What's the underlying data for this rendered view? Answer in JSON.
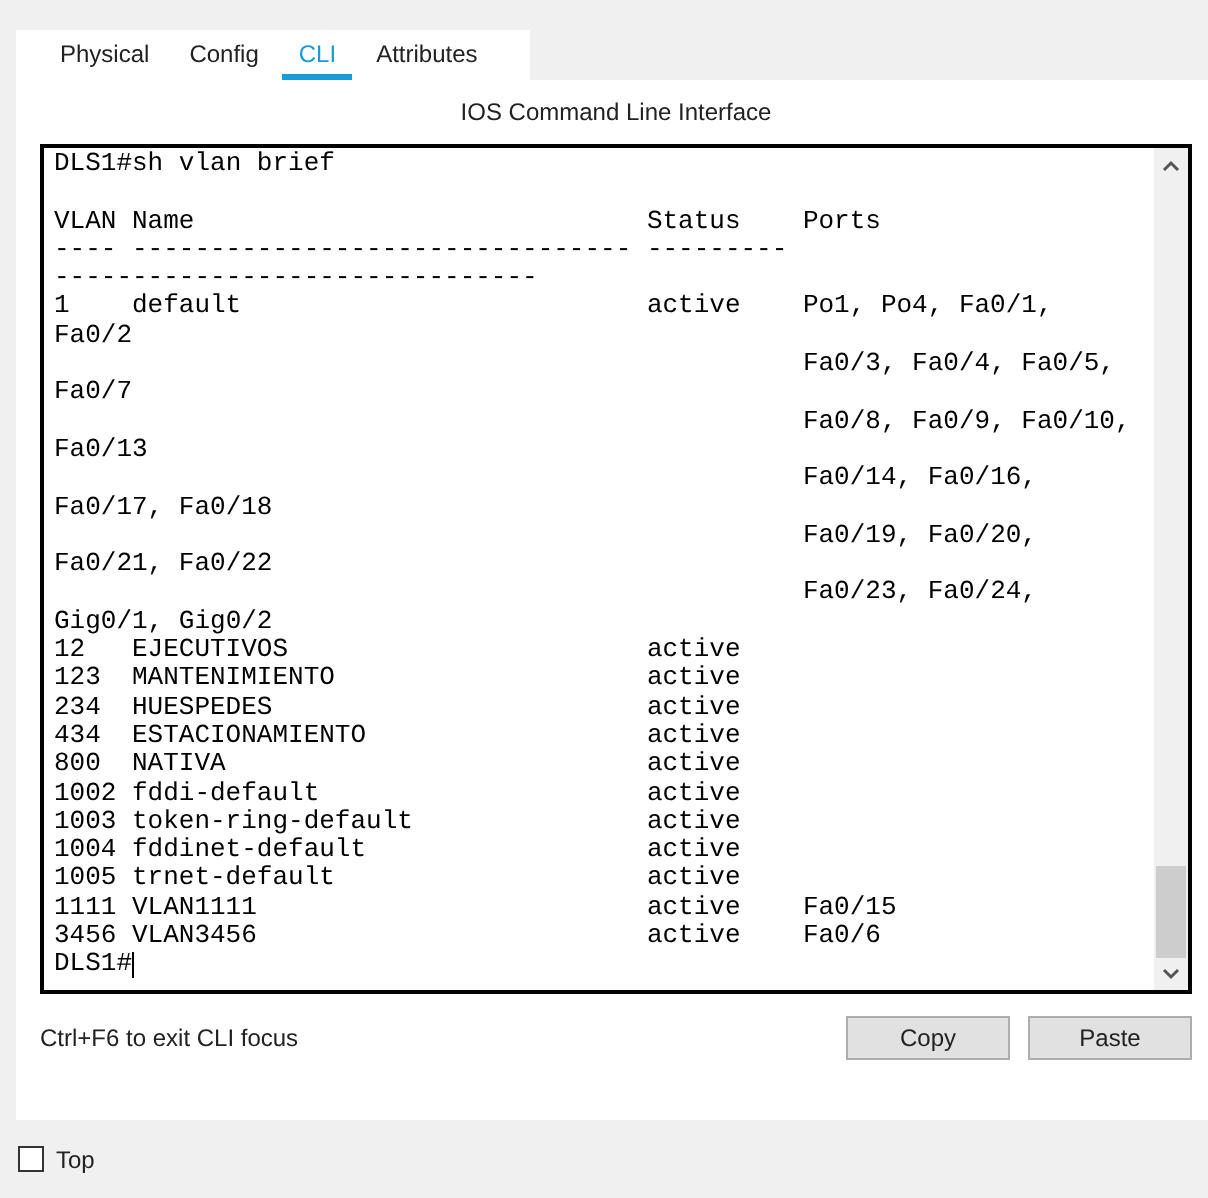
{
  "tabs": [
    {
      "label": "Physical",
      "selected": false
    },
    {
      "label": "Config",
      "selected": false
    },
    {
      "label": "CLI",
      "selected": true
    },
    {
      "label": "Attributes",
      "selected": false
    }
  ],
  "panel_title": "IOS Command Line Interface",
  "terminal": {
    "lines": [
      {
        "kind": "line",
        "text": "DLS1#sh vlan brief"
      },
      {
        "kind": "blank"
      },
      {
        "kind": "row",
        "cells": [
          "VLAN",
          "Name",
          "Status",
          "Ports"
        ]
      },
      {
        "kind": "row",
        "cells": [
          "----",
          "--------------------------------",
          "---------"
        ]
      },
      {
        "kind": "line",
        "text": "-------------------------------"
      },
      {
        "kind": "row",
        "cells": [
          "1",
          "default",
          "active",
          "Po1, Po4, Fa0/1,"
        ]
      },
      {
        "kind": "line",
        "text": "Fa0/2"
      },
      {
        "kind": "cont",
        "text": "Fa0/3, Fa0/4, Fa0/5,"
      },
      {
        "kind": "line",
        "text": "Fa0/7"
      },
      {
        "kind": "cont",
        "text": "Fa0/8, Fa0/9, Fa0/10,"
      },
      {
        "kind": "line",
        "text": "Fa0/13"
      },
      {
        "kind": "cont",
        "text": "Fa0/14, Fa0/16,"
      },
      {
        "kind": "line",
        "text": "Fa0/17, Fa0/18"
      },
      {
        "kind": "cont",
        "text": "Fa0/19, Fa0/20,"
      },
      {
        "kind": "line",
        "text": "Fa0/21, Fa0/22"
      },
      {
        "kind": "cont",
        "text": "Fa0/23, Fa0/24,"
      },
      {
        "kind": "line",
        "text": "Gig0/1, Gig0/2"
      },
      {
        "kind": "row",
        "cells": [
          "12",
          "EJECUTIVOS",
          "active"
        ]
      },
      {
        "kind": "row",
        "cells": [
          "123",
          "MANTENIMIENTO",
          "active"
        ]
      },
      {
        "kind": "row",
        "cells": [
          "234",
          "HUESPEDES",
          "active"
        ]
      },
      {
        "kind": "row",
        "cells": [
          "434",
          "ESTACIONAMIENTO",
          "active"
        ]
      },
      {
        "kind": "row",
        "cells": [
          "800",
          "NATIVA",
          "active"
        ]
      },
      {
        "kind": "row",
        "cells": [
          "1002",
          "fddi-default",
          "active"
        ]
      },
      {
        "kind": "row",
        "cells": [
          "1003",
          "token-ring-default",
          "active"
        ]
      },
      {
        "kind": "row",
        "cells": [
          "1004",
          "fddinet-default",
          "active"
        ]
      },
      {
        "kind": "row",
        "cells": [
          "1005",
          "trnet-default",
          "active"
        ]
      },
      {
        "kind": "row",
        "cells": [
          "1111",
          "VLAN1111",
          "active",
          "Fa0/15"
        ]
      },
      {
        "kind": "row",
        "cells": [
          "3456",
          "VLAN3456",
          "active",
          "Fa0/6"
        ]
      },
      {
        "kind": "prompt",
        "text": "DLS1#"
      }
    ]
  },
  "hint": "Ctrl+F6 to exit CLI focus",
  "buttons": [
    "Copy",
    "Paste"
  ],
  "top_checkbox": {
    "label": "Top",
    "checked": false
  }
}
